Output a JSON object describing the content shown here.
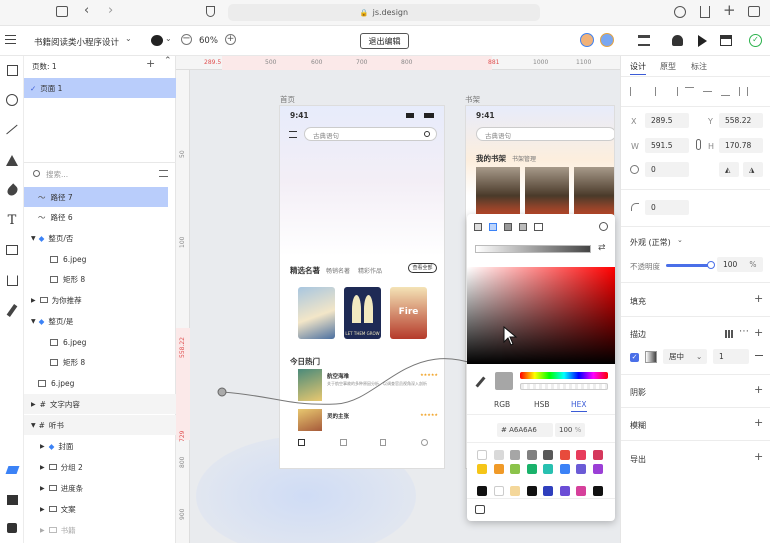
{
  "browser": {
    "url": "js.design"
  },
  "header": {
    "project_title": "书籍阅读类小程序设计",
    "zoom": "60%",
    "exit_label": "退出编辑"
  },
  "layers": {
    "page_label": "页数: 1",
    "page_name": "页面 1",
    "search_placeholder": "搜索...",
    "items": [
      {
        "label": "路径 7"
      },
      {
        "label": "路径 6"
      },
      {
        "label": "整页/否"
      },
      {
        "label": "6.jpeg"
      },
      {
        "label": "矩形 8"
      },
      {
        "label": "为你推荐"
      },
      {
        "label": "整页/是"
      },
      {
        "label": "6.jpeg"
      },
      {
        "label": "矩形 8"
      },
      {
        "label": "6.jpeg"
      },
      {
        "label": "文字内容"
      },
      {
        "label": "听书"
      },
      {
        "label": "封面"
      },
      {
        "label": "分组 2"
      },
      {
        "label": "进度条"
      },
      {
        "label": "文案"
      },
      {
        "label": "书籍"
      }
    ]
  },
  "ruler": {
    "top": [
      "289.5",
      "500",
      "600",
      "700",
      "800",
      "881",
      "1000",
      "1100"
    ],
    "left": [
      "50",
      "100",
      "558.22",
      "729",
      "800",
      "900"
    ]
  },
  "canvas": {
    "frame1_label": "首页",
    "frame2_label": "书架",
    "phone1": {
      "time": "9:41",
      "search": "古典语句",
      "section1": "精选名著",
      "tabs": [
        "畅销名著",
        "精彩作品"
      ],
      "more": "查看全部",
      "section2": "今日热门",
      "items": [
        {
          "title": "航空海难",
          "desc": "关于航空事故的多种原因分析，以调查官员视角深入剖析"
        },
        {
          "title": "灵的主张",
          "desc": ""
        }
      ],
      "book_captions": [
        "LET THEM GROW",
        "Fire"
      ]
    },
    "phone2": {
      "time": "9:41",
      "search": "古典语句",
      "tab_active": "我的书架",
      "tab_other": "书架管理"
    }
  },
  "picker": {
    "modes": [
      "RGB",
      "HSB",
      "HEX"
    ],
    "hex_value": "A6A6A6",
    "opacity": "100",
    "pct": "%",
    "swatch_colors_row1": [
      "#ffffff",
      "#d9d9d9",
      "#a6a6a6",
      "#808080",
      "#595959",
      "#e84b3c",
      "#e83c5c",
      "#d5385c"
    ],
    "swatch_colors_row2": [
      "#f5c518",
      "#f09a28",
      "#8bc34a",
      "#1ab26b",
      "#28c0b0",
      "#3b82f6",
      "#6b5bd6",
      "#9b3fd6"
    ],
    "swatch_colors_row3": [
      "#111111",
      "#ffffff",
      "#f4d79a",
      "#111111",
      "#2f3fbd",
      "#6b4dd6",
      "#d6409b",
      "#111111"
    ]
  },
  "right": {
    "tabs": [
      "设计",
      "原型",
      "标注"
    ],
    "x_label": "X",
    "x_value": "289.5",
    "y_label": "Y",
    "y_value": "558.22",
    "w_label": "W",
    "w_value": "591.5",
    "h_label": "H",
    "h_value": "170.78",
    "rotation": "0",
    "radius": "0",
    "appearance": "外观 (正常)",
    "opacity_label": "不透明度",
    "opacity_value": "100",
    "opacity_unit": "%",
    "fill": "填充",
    "stroke": "描边",
    "stroke_position": "居中",
    "stroke_width": "1",
    "shadow": "阴影",
    "blur": "模糊",
    "export": "导出"
  }
}
